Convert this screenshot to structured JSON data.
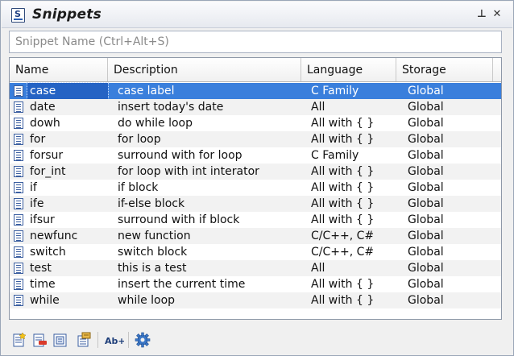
{
  "panel": {
    "title": "Snippets",
    "pin_glyph": "⊥",
    "close_glyph": "✕"
  },
  "search": {
    "placeholder": "Snippet Name (Ctrl+Alt+S)",
    "value": ""
  },
  "table": {
    "columns": [
      "Name",
      "Description",
      "Language",
      "Storage"
    ],
    "selected_index": 0,
    "rows": [
      {
        "name": "case",
        "description": "case label",
        "language": "C Family",
        "storage": "Global"
      },
      {
        "name": "date",
        "description": "insert today's date",
        "language": "All",
        "storage": "Global"
      },
      {
        "name": "dowh",
        "description": "do while loop",
        "language": "All with { }",
        "storage": "Global"
      },
      {
        "name": "for",
        "description": "for loop",
        "language": "All with { }",
        "storage": "Global"
      },
      {
        "name": "forsur",
        "description": "surround with for loop",
        "language": "C Family",
        "storage": "Global"
      },
      {
        "name": "for_int",
        "description": "for loop with int interator",
        "language": "All with { }",
        "storage": "Global"
      },
      {
        "name": "if",
        "description": "if block",
        "language": "All with { }",
        "storage": "Global"
      },
      {
        "name": "ife",
        "description": "if-else block",
        "language": "All with { }",
        "storage": "Global"
      },
      {
        "name": "ifsur",
        "description": "surround with if block",
        "language": "All with { }",
        "storage": "Global"
      },
      {
        "name": "newfunc",
        "description": "new function",
        "language": "C/C++, C#",
        "storage": "Global"
      },
      {
        "name": "switch",
        "description": "switch block",
        "language": "C/C++, C#",
        "storage": "Global"
      },
      {
        "name": "test",
        "description": "this is a test",
        "language": "All",
        "storage": "Global"
      },
      {
        "name": "time",
        "description": "insert the current time",
        "language": "All with { }",
        "storage": "Global"
      },
      {
        "name": "while",
        "description": "while loop",
        "language": "All with { }",
        "storage": "Global"
      }
    ]
  },
  "toolbar": {
    "items": [
      {
        "icon": "new-snippet-icon"
      },
      {
        "icon": "delete-snippet-icon"
      },
      {
        "icon": "edit-snippet-icon"
      },
      {
        "icon": "snippet-properties-icon"
      },
      {
        "icon": "rename-snippet-icon",
        "label": "Ab+"
      },
      {
        "icon": "settings-gear-icon"
      }
    ]
  },
  "colors": {
    "selection": "#3a7fdc",
    "titlebar": "#e6e9ef",
    "alt_row": "#f2f2f2"
  }
}
